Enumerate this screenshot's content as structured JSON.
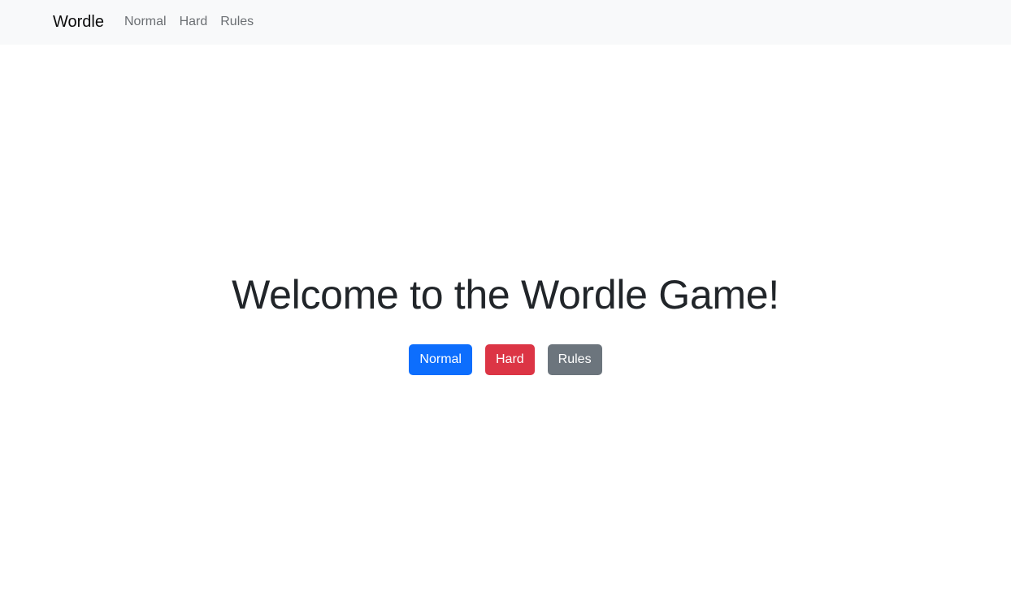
{
  "navbar": {
    "brand": "Wordle",
    "links": [
      {
        "label": "Normal"
      },
      {
        "label": "Hard"
      },
      {
        "label": "Rules"
      }
    ]
  },
  "main": {
    "title": "Welcome to the Wordle Game!",
    "buttons": {
      "normal": "Normal",
      "hard": "Hard",
      "rules": "Rules"
    }
  },
  "colors": {
    "navbar_bg": "#f8f9fa",
    "primary": "#0d6efd",
    "danger": "#dc3545",
    "secondary": "#6c757d"
  }
}
